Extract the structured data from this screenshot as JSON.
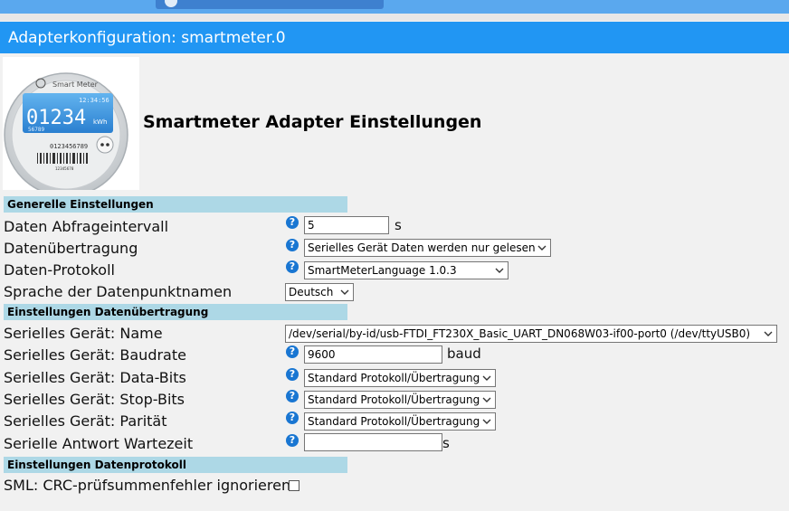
{
  "window": {
    "title": "Adapterkonfiguration: smartmeter.0"
  },
  "logo": {
    "brand": "Smart Meter",
    "time": "12:34:56",
    "reading": "01234",
    "unit": "kWh",
    "sub_reading": "56789",
    "serial": "0123456789",
    "barcode_number": "12345678"
  },
  "heading": "Smartmeter Adapter Einstellungen",
  "sections": {
    "general": "Generelle Einstellungen",
    "transfer": "Einstellungen Datenübertragung",
    "protocol": "Einstellungen Datenprotokoll"
  },
  "fields": {
    "interval": {
      "label": "Daten Abfrageintervall",
      "value": "5",
      "unit": "s"
    },
    "transfer_mode": {
      "label": "Datenübertragung",
      "value": "Serielles Gerät Daten werden nur gelesen"
    },
    "protocol": {
      "label": "Daten-Protokoll",
      "value": "SmartMeterLanguage 1.0.3"
    },
    "language": {
      "label": "Sprache der Datenpunktnamen",
      "value": "Deutsch"
    },
    "serial_name": {
      "label": "Serielles Gerät: Name",
      "value": "/dev/serial/by-id/usb-FTDI_FT230X_Basic_UART_DN068W03-if00-port0 (/dev/ttyUSB0)"
    },
    "baudrate": {
      "label": "Serielles Gerät: Baudrate",
      "value": "9600",
      "unit": "baud"
    },
    "databits": {
      "label": "Serielles Gerät: Data-Bits",
      "value": "Standard Protokoll/Übertragung"
    },
    "stopbits": {
      "label": "Serielles Gerät: Stop-Bits",
      "value": "Standard Protokoll/Übertragung"
    },
    "parity": {
      "label": "Serielles Gerät: Parität",
      "value": "Standard Protokoll/Übertragung"
    },
    "response_wait": {
      "label": "Serielle Antwort Wartezeit",
      "value": "",
      "unit": "s"
    },
    "sml_crc": {
      "label": "SML: CRC-prüfsummenfehler ignorieren",
      "checked": false
    }
  },
  "help_glyph": "?",
  "colors": {
    "title_bar": "#2196f3",
    "section_bg": "#add8e6",
    "help_icon": "#1976d2",
    "top_bar": "#5aa8ee"
  }
}
